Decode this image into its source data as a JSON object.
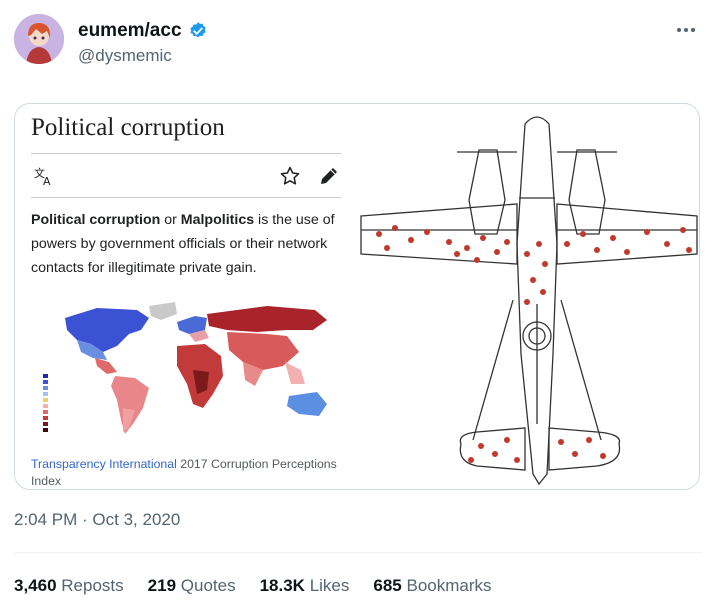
{
  "author": {
    "display_name": "eumem/acc",
    "handle": "@dysmemic",
    "verified": true,
    "verified_color": "#1d9bf0"
  },
  "icons": {
    "more": "more-horizontal-icon",
    "verified": "verified-badge-icon",
    "language": "translate-icon",
    "watch": "star-icon",
    "edit": "pencil-icon"
  },
  "wiki": {
    "title": "Political corruption",
    "term1": "Political corruption",
    "or": " or ",
    "term2": "Malpolitics",
    "definition": " is the use of powers by government officials or their network contacts for illegitimate private gain.",
    "caption_link": "Transparency International",
    "caption_rest": " 2017 Corruption Perceptions Index"
  },
  "timestamp": "2:04 PM · Oct 3, 2020",
  "stats": [
    {
      "count": "3,460",
      "label": "Reposts"
    },
    {
      "count": "219",
      "label": "Quotes"
    },
    {
      "count": "18.3K",
      "label": "Likes"
    },
    {
      "count": "685",
      "label": "Bookmarks"
    }
  ]
}
